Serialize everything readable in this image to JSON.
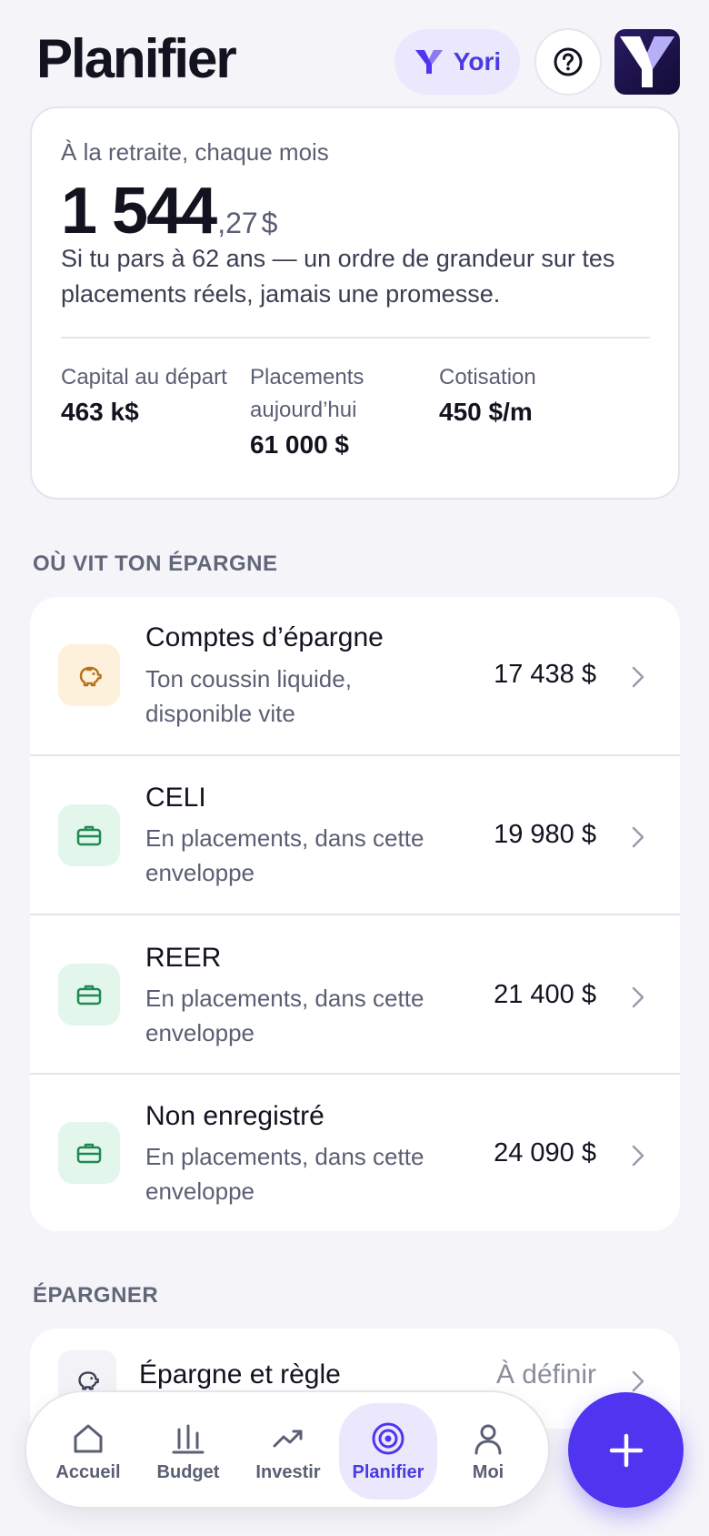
{
  "header": {
    "title": "Planifier",
    "assistant_label": "Yori"
  },
  "summary": {
    "caption": "À la retraite, chaque mois",
    "amount_int": "1 544",
    "amount_cents": ",27",
    "currency": "$",
    "description": "Si tu pars à 62 ans — un ordre de grandeur sur tes placements réels, jamais une promesse.",
    "stats": [
      {
        "label": "Capital au départ",
        "value": "463 k$"
      },
      {
        "label": "Placements aujourd’hui",
        "value": "61 000 $"
      },
      {
        "label": "Cotisation",
        "value": "450 $/m"
      }
    ]
  },
  "savings_section": {
    "title": "OÙ VIT TON ÉPARGNE",
    "accounts": [
      {
        "title": "Comptes d’épargne",
        "subtitle": "Ton coussin liquide, disponible vite",
        "amount": "17 438 $",
        "icon": "piggy-bank-icon",
        "icon_bg": "#fdf1dc",
        "icon_color": "#b5741c"
      },
      {
        "title": "CELI",
        "subtitle": "En placements, dans cette enveloppe",
        "amount": "19 980 $",
        "icon": "briefcase-icon",
        "icon_bg": "#e3f6ec",
        "icon_color": "#1e8a52"
      },
      {
        "title": "REER",
        "subtitle": "En placements, dans cette enveloppe",
        "amount": "21 400 $",
        "icon": "briefcase-icon",
        "icon_bg": "#e3f6ec",
        "icon_color": "#1e8a52"
      },
      {
        "title": "Non enregistré",
        "subtitle": "En placements, dans cette enveloppe",
        "amount": "24 090 $",
        "icon": "briefcase-icon",
        "icon_bg": "#e3f6ec",
        "icon_color": "#1e8a52"
      }
    ]
  },
  "save_section": {
    "title": "ÉPARGNER",
    "item_title": "Épargne et règle",
    "item_status": "À définir"
  },
  "nav": {
    "items": [
      {
        "label": "Accueil",
        "icon": "home-icon"
      },
      {
        "label": "Budget",
        "icon": "bar-chart-icon"
      },
      {
        "label": "Investir",
        "icon": "trend-up-icon"
      },
      {
        "label": "Planifier",
        "icon": "target-icon",
        "active": true
      },
      {
        "label": "Moi",
        "icon": "user-icon"
      }
    ]
  },
  "colors": {
    "accent": "#4f35f0",
    "accent_text": "#4b3ae0",
    "accent_soft": "#ebe8fd",
    "background": "#f4f4f9"
  }
}
